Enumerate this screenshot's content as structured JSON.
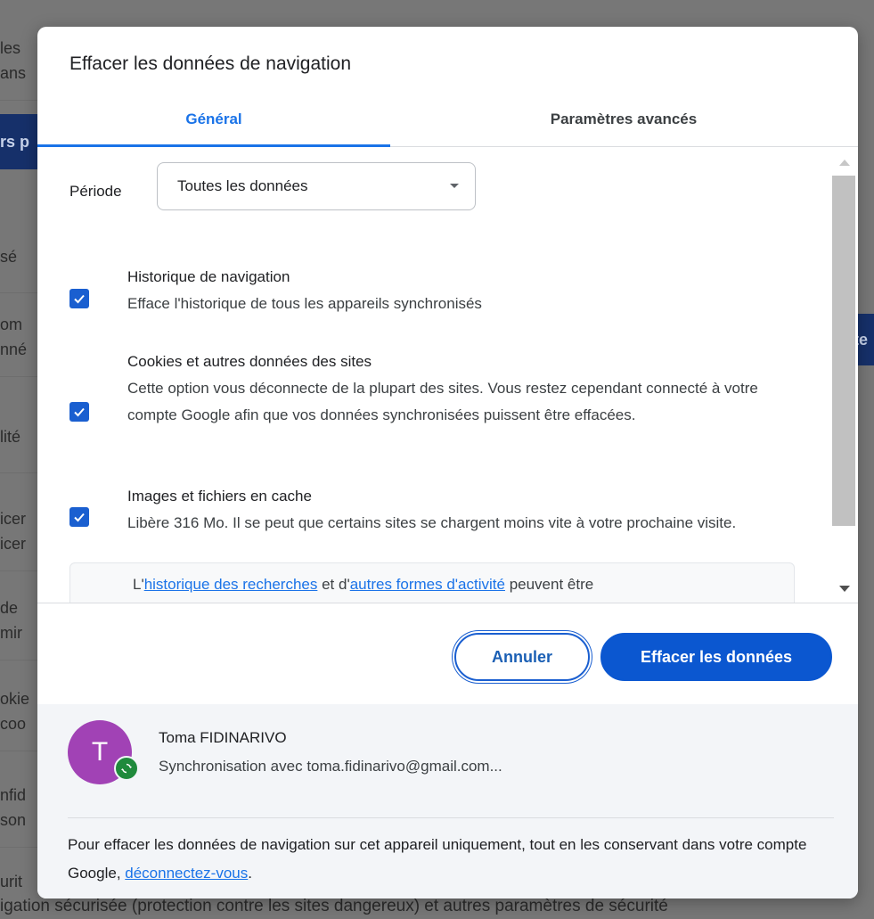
{
  "background": {
    "rows": [
      "les\nans",
      "rs p",
      "sé",
      "om\nnné",
      "lité",
      "icer\nicer",
      "de\nmir",
      "okie\ncoo",
      "nfid\nson",
      "urit"
    ],
    "right_button_fragment": "te",
    "bottom_line": "igation sécurisée (protection contre les sites dangereux) et autres paramètres de sécurité"
  },
  "dialog": {
    "title": "Effacer les données de navigation",
    "tabs": [
      {
        "label": "Général",
        "active": true
      },
      {
        "label": "Paramètres avancés",
        "active": false
      }
    ],
    "period": {
      "label": "Période",
      "selected": "Toutes les données"
    },
    "options": [
      {
        "title": "Historique de navigation",
        "description": "Efface l'historique de tous les appareils synchronisés",
        "checked": true
      },
      {
        "title": "Cookies et autres données des sites",
        "description": "Cette option vous déconnecte de la plupart des sites. Vous restez cependant connecté à votre compte Google afin que vos données synchronisées puissent être effacées.",
        "checked": true
      },
      {
        "title": "Images et fichiers en cache",
        "description": "Libère 316 Mo. Il se peut que certains sites se chargent moins vite à votre prochaine visite.",
        "checked": true
      }
    ],
    "info": {
      "prefix": "L'",
      "link1": "historique des recherches",
      "middle": " et d'",
      "link2": "autres formes d'activité",
      "suffix": " peuvent être"
    },
    "buttons": {
      "cancel": "Annuler",
      "clear": "Effacer les données"
    },
    "account": {
      "initial": "T",
      "name": "Toma FIDINARIVO",
      "sync_text": "Synchronisation avec toma.fidinarivo@gmail.com..."
    },
    "footer_note": {
      "text": "Pour effacer les données de navigation sur cet appareil uniquement, tout en les conservant dans votre compte Google, ",
      "link": "déconnectez-vous",
      "suffix": "."
    },
    "colors": {
      "accent": "#1a73e8",
      "primary_button": "#0b57d0",
      "avatar": "#a142b5",
      "sync_badge": "#1f8a3c"
    }
  }
}
